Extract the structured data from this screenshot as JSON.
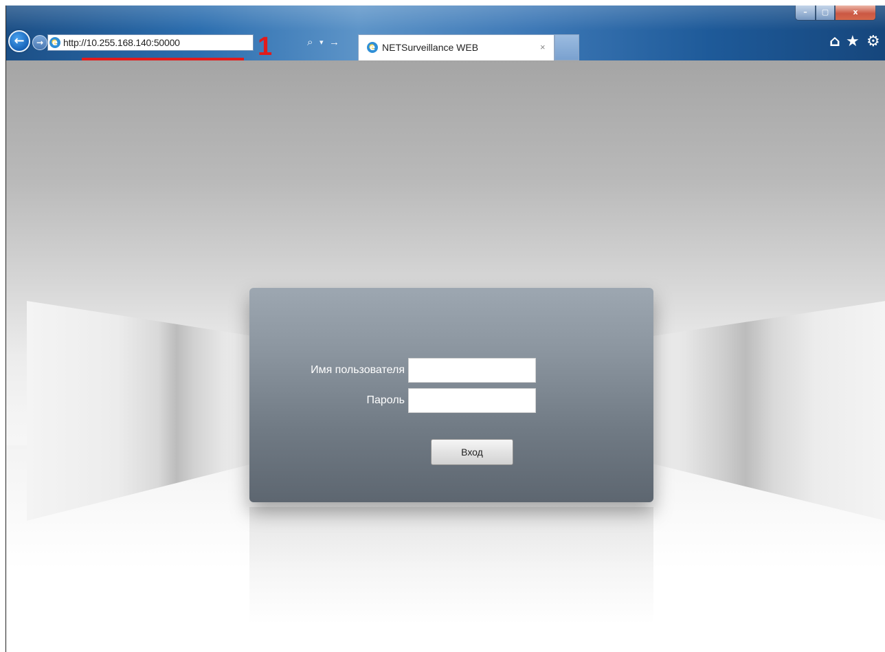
{
  "browser": {
    "address_url": "http://10.255.168.140:50000",
    "tab_title": "NETSurveillance WEB",
    "tab_close_glyph": "×",
    "search_glyph": "⌕",
    "dropdown_glyph": "▾",
    "go_glyph": "→",
    "back_glyph": "←",
    "forward_glyph": "→",
    "min_glyph": "–",
    "max_glyph": "▢",
    "close_glyph": "x",
    "home_glyph": "⌂",
    "favorites_glyph": "★",
    "tools_glyph": "⚙",
    "icons": [
      "back-icon",
      "forward-icon",
      "ie-logo-icon",
      "search-icon",
      "home-icon",
      "star-icon",
      "gear-icon"
    ]
  },
  "annotation": {
    "number": "1",
    "color": "#e21b1b"
  },
  "login": {
    "username_label": "Имя пользователя",
    "password_label": "Пароль",
    "username_value": "",
    "password_value": "",
    "submit_label": "Вход"
  },
  "colors": {
    "toolbar_blue": "#2c6eaf",
    "panel_gray": "#717b85"
  }
}
